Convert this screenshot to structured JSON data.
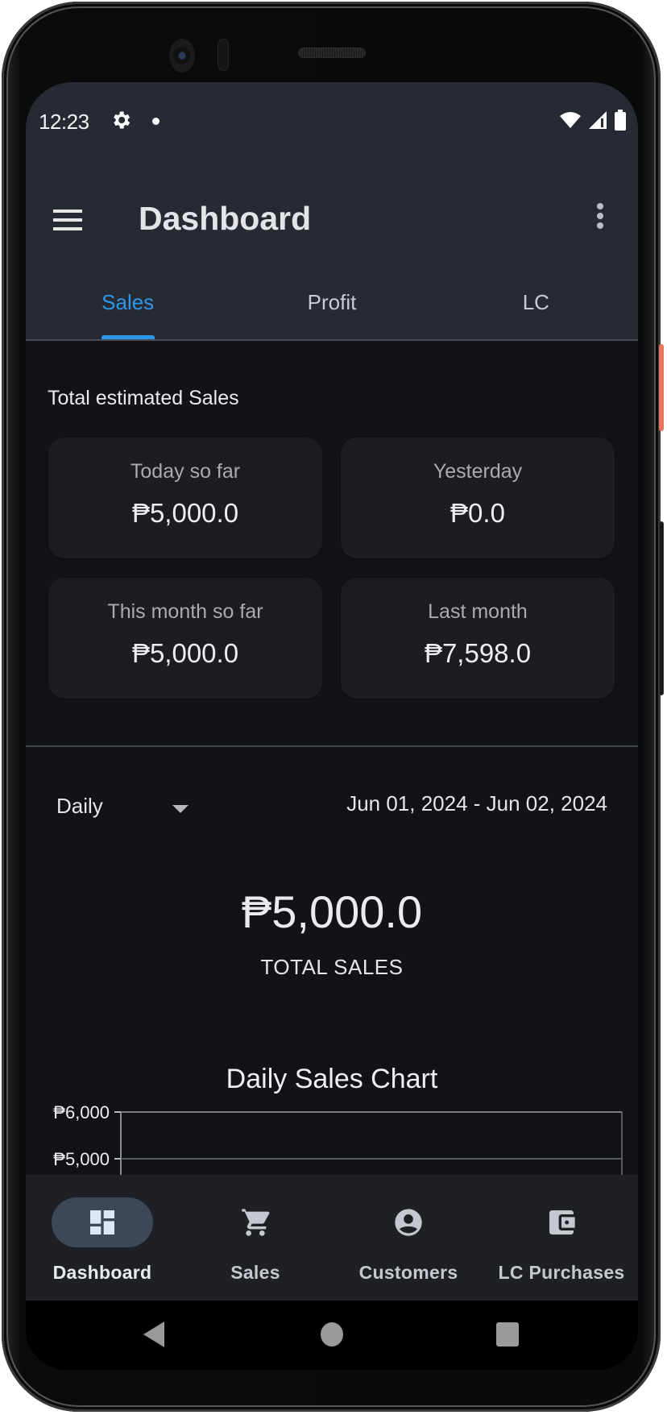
{
  "status_bar": {
    "time": "12:23",
    "icons": [
      "settings-icon",
      "notification-dot-icon",
      "wifi-icon",
      "cell-signal-icon",
      "battery-icon"
    ]
  },
  "app_bar": {
    "title": "Dashboard",
    "menu_icon": "menu-icon",
    "more_icon": "more-vert-icon"
  },
  "tabs": [
    {
      "label": "Sales",
      "active": true
    },
    {
      "label": "Profit",
      "active": false
    },
    {
      "label": "LC",
      "active": false
    }
  ],
  "summary": {
    "title": "Total estimated Sales",
    "cards": [
      {
        "label": "Today so far",
        "value": "₱5,000.0"
      },
      {
        "label": "Yesterday",
        "value": "₱0.0"
      },
      {
        "label": "This month so far",
        "value": "₱5,000.0"
      },
      {
        "label": "Last month",
        "value": "₱7,598.0"
      }
    ]
  },
  "filters": {
    "period": "Daily",
    "date_range": "Jun 01, 2024 - Jun 02, 2024"
  },
  "total": {
    "value": "₱5,000.0",
    "label": "TOTAL SALES"
  },
  "chart_data": {
    "type": "line",
    "title": "Daily Sales Chart",
    "xlabel": "",
    "ylabel": "",
    "y_ticks": [
      {
        "value": 6000,
        "label": "₱6,000"
      },
      {
        "value": 5000,
        "label": "₱5,000"
      }
    ],
    "ylim_visible": [
      5000,
      6000
    ],
    "grid": true,
    "series": []
  },
  "bottom_nav": [
    {
      "label": "Dashboard",
      "icon": "dashboard-icon",
      "active": true
    },
    {
      "label": "Sales",
      "icon": "cart-icon",
      "active": false
    },
    {
      "label": "Customers",
      "icon": "account-circle-icon",
      "active": false
    },
    {
      "label": "LC Purchases",
      "icon": "wallet-icon",
      "active": false
    }
  ],
  "colors": {
    "accent": "#2e96e8",
    "background": "#121318",
    "app_bar": "#262a33",
    "card": "#1b1d22",
    "nav_active_pill": "#3a4858"
  }
}
